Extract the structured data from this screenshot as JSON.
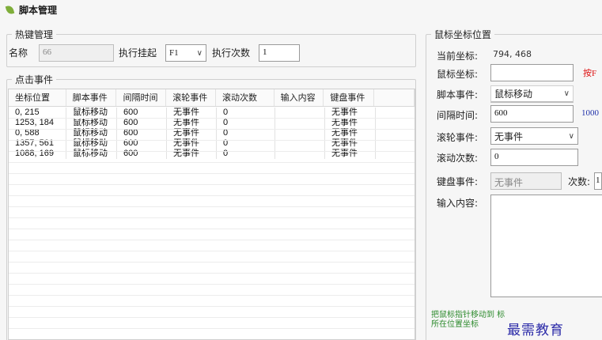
{
  "window": {
    "title": "脚本管理"
  },
  "hotkey": {
    "legend": "热键管理",
    "name_label": "名称",
    "name_value": "66",
    "trigger_label": "执行挂起",
    "trigger_value": "F1",
    "count_label": "执行次数",
    "count_value": "1"
  },
  "events": {
    "legend": "点击事件",
    "columns": [
      "坐标位置",
      "脚本事件",
      "间隔时间",
      "滚轮事件",
      "滚动次数",
      "输入内容",
      "键盘事件"
    ],
    "rows": [
      [
        "0, 215",
        "鼠标移动",
        "600",
        "无事件",
        "0",
        "",
        "无事件"
      ],
      [
        "1253, 184",
        "鼠标移动",
        "600",
        "无事件",
        "0",
        "",
        "无事件"
      ],
      [
        "0, 588",
        "鼠标移动",
        "600",
        "无事件",
        "0",
        "",
        "无事件"
      ],
      [
        "1357, 561",
        "鼠标移动",
        "600",
        "无事件",
        "0",
        "",
        "无事件"
      ],
      [
        "1088, 169",
        "鼠标移动",
        "600",
        "无事件",
        "0",
        "",
        "无事件"
      ]
    ]
  },
  "mouse": {
    "legend": "鼠标坐标位置",
    "current_label": "当前坐标:",
    "current_value": "794, 468",
    "coord_label": "鼠标坐标:",
    "coord_value": "",
    "coord_hint": "按F",
    "script_event_label": "脚本事件:",
    "script_event_value": "鼠标移动",
    "interval_label": "间隔时间:",
    "interval_value": "600",
    "interval_hint": "1000",
    "wheel_label": "滚轮事件:",
    "wheel_value": "无事件",
    "scroll_label": "滚动次数:",
    "scroll_value": "0",
    "key_label": "键盘事件:",
    "key_value": "无事件",
    "key_count_label": "次数:",
    "key_count_value": "1",
    "input_label": "输入内容:",
    "input_value": "",
    "pointer_hint": "把鼠标指针移动到 标所在位置坐标"
  },
  "watermark": "最需教育"
}
